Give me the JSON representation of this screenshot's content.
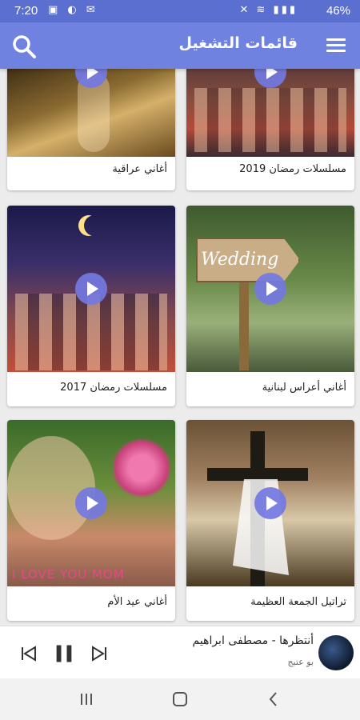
{
  "status": {
    "time": "7:20",
    "battery": "46%"
  },
  "appbar": {
    "title": "قائمات التشغيل"
  },
  "playlists": [
    {
      "label": "أغاني عراقية"
    },
    {
      "label": "مسلسلات رمضان 2019"
    },
    {
      "label": "مسلسلات رمضان 2017"
    },
    {
      "label": "أغاني أعراس لبنانية"
    },
    {
      "label": "أغاني عيد الأم"
    },
    {
      "label": "تراتيل الجمعة العظيمة"
    }
  ],
  "image_text": {
    "wedding": "Wedding",
    "mom": "I LOVE YOU MOM"
  },
  "player": {
    "track": "أنتظرها - مصطفى ابراهيم",
    "subtitle": "بو عتبج"
  },
  "colors": {
    "statusbar": "#5b6fd1",
    "appbar": "#6f82e0",
    "play_button": "#7378e1"
  },
  "icons": [
    "search-icon",
    "menu-icon",
    "play-icon",
    "previous-icon",
    "pause-icon",
    "next-icon",
    "recents-icon",
    "home-icon",
    "back-icon"
  ]
}
